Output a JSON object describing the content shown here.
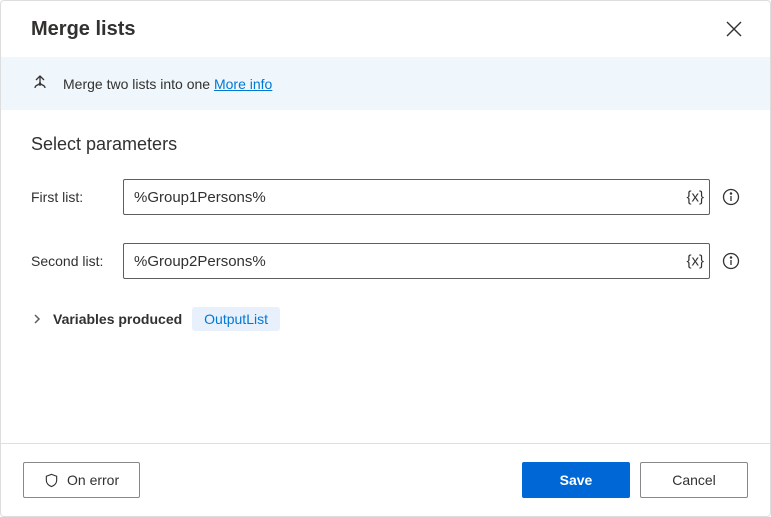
{
  "header": {
    "title": "Merge lists"
  },
  "banner": {
    "text": "Merge two lists into one",
    "link": "More info"
  },
  "section": {
    "title": "Select parameters"
  },
  "fields": {
    "first": {
      "label": "First list:",
      "value": "%Group1Persons%"
    },
    "second": {
      "label": "Second list:",
      "value": "%Group2Persons%"
    }
  },
  "variables": {
    "label": "Variables produced",
    "output": "OutputList"
  },
  "footer": {
    "onError": "On error",
    "save": "Save",
    "cancel": "Cancel"
  }
}
